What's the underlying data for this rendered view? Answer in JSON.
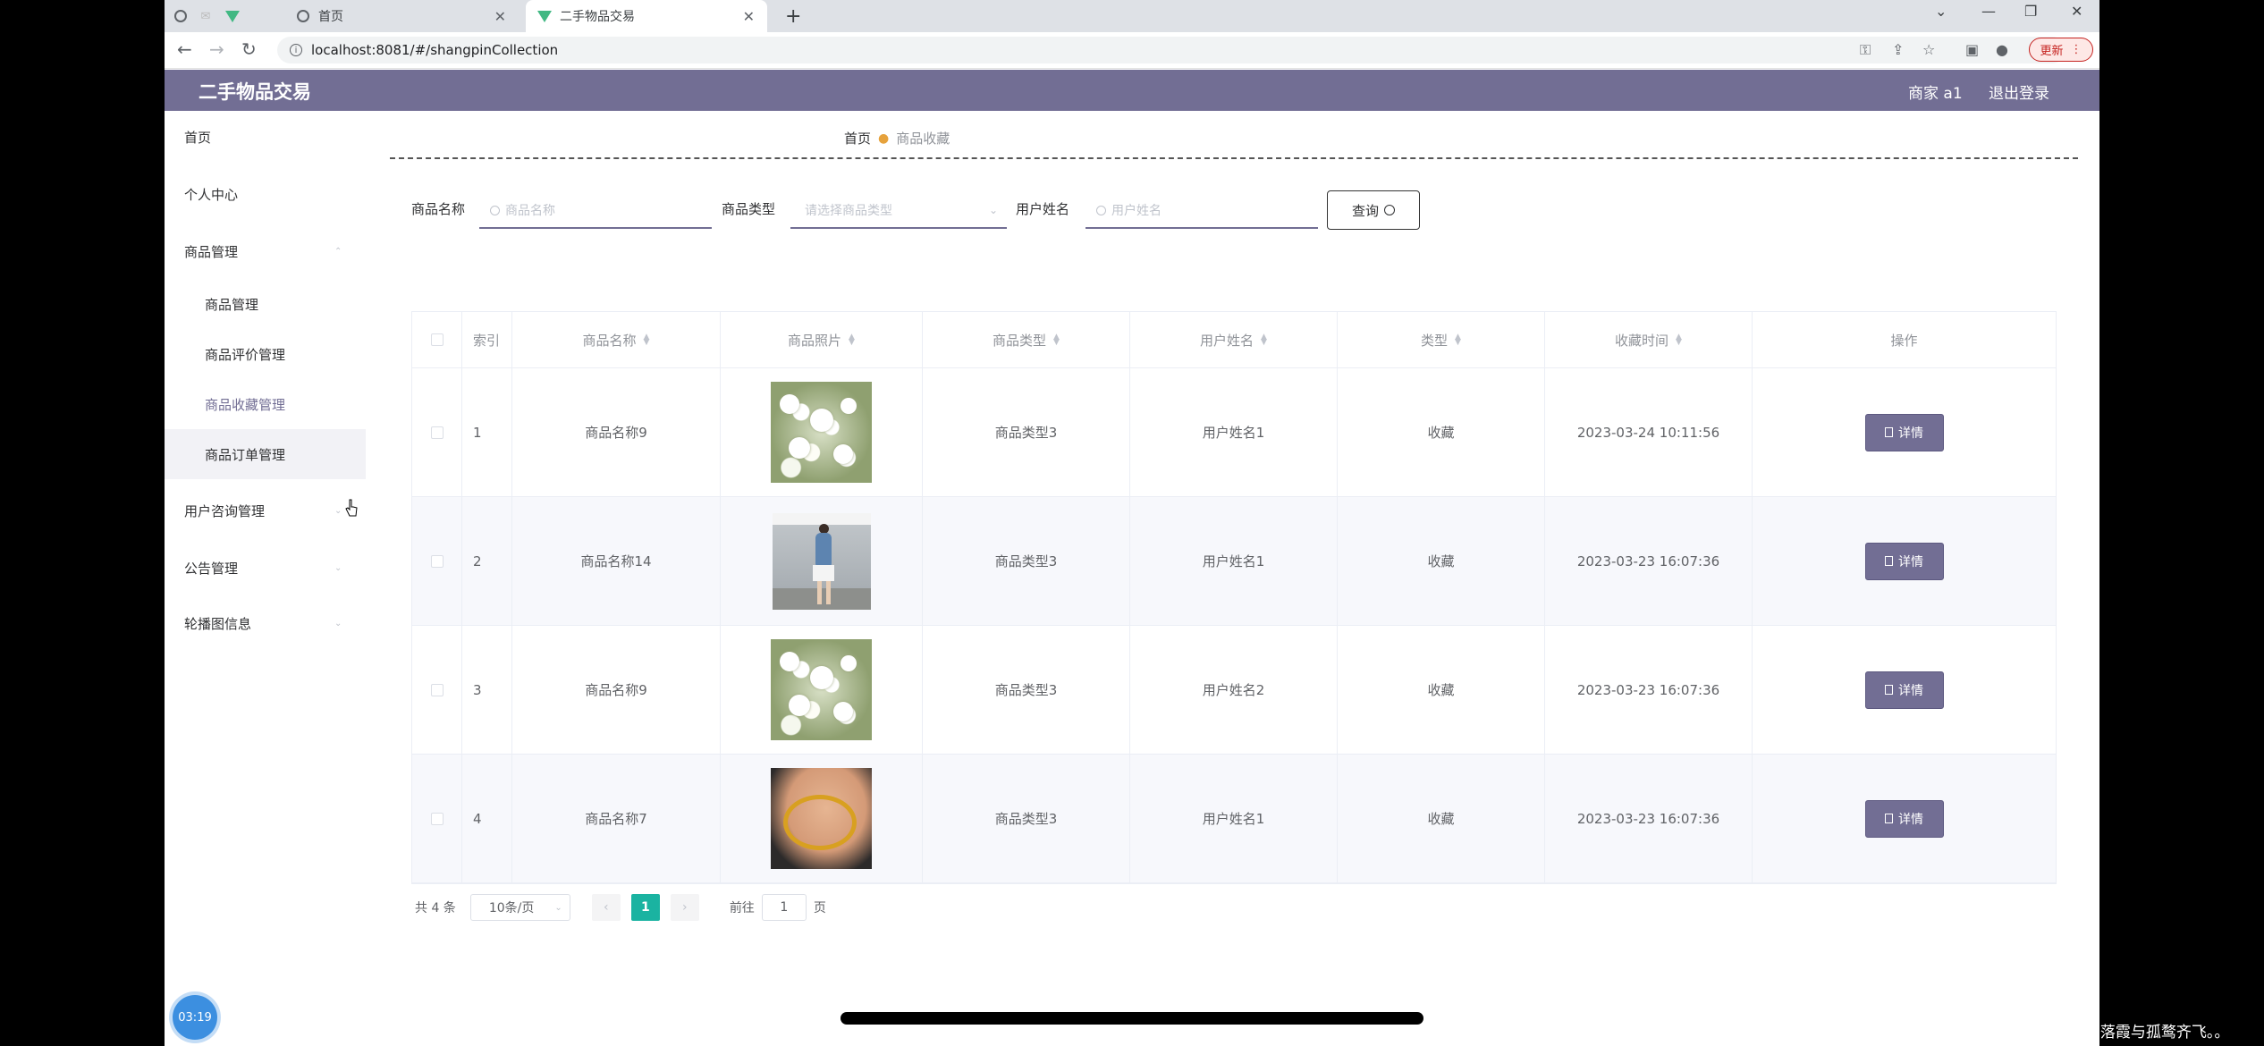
{
  "browser": {
    "tabs": [
      {
        "title": "",
        "icon": "globe-icon"
      },
      {
        "title": "",
        "icon": "mail-icon"
      },
      {
        "title": "",
        "icon": "vue-icon"
      },
      {
        "title": "首页",
        "icon": "globe-icon"
      },
      {
        "title": "二手物品交易",
        "icon": "vue-icon",
        "active": true
      }
    ],
    "new_tab": "+",
    "url": "localhost:8081/#/shangpinCollection",
    "update_label": "更新"
  },
  "header": {
    "title": "二手物品交易",
    "user": "商家 a1",
    "logout": "退出登录"
  },
  "sidebar": {
    "items": [
      {
        "label": "首页"
      },
      {
        "label": "个人中心"
      },
      {
        "label": "商品管理",
        "expanded": true
      },
      {
        "label": "用户咨询管理"
      },
      {
        "label": "公告管理"
      },
      {
        "label": "轮播图信息"
      }
    ],
    "sub_items": [
      {
        "label": "商品管理"
      },
      {
        "label": "商品评价管理"
      },
      {
        "label": "商品收藏管理",
        "active": true
      },
      {
        "label": "商品订单管理"
      }
    ]
  },
  "breadcrumb": {
    "home": "首页",
    "current": "商品收藏"
  },
  "filters": {
    "name_label": "商品名称",
    "name_placeholder": "商品名称",
    "type_label": "商品类型",
    "type_placeholder": "请选择商品类型",
    "user_label": "用户姓名",
    "user_placeholder": "用户姓名",
    "query_label": "查询"
  },
  "table": {
    "columns": [
      "索引",
      "商品名称",
      "商品照片",
      "商品类型",
      "用户姓名",
      "类型",
      "收藏时间",
      "操作"
    ],
    "detail_label": "详情",
    "rows": [
      {
        "index": "1",
        "name": "商品名称9",
        "image": "flowers",
        "category": "商品类型3",
        "user": "用户姓名1",
        "type": "收藏",
        "time": "2023-03-24 10:11:56"
      },
      {
        "index": "2",
        "name": "商品名称14",
        "image": "person",
        "category": "商品类型3",
        "user": "用户姓名1",
        "type": "收藏",
        "time": "2023-03-23 16:07:36"
      },
      {
        "index": "3",
        "name": "商品名称9",
        "image": "flowers",
        "category": "商品类型3",
        "user": "用户姓名2",
        "type": "收藏",
        "time": "2023-03-23 16:07:36"
      },
      {
        "index": "4",
        "name": "商品名称7",
        "image": "bangle",
        "category": "商品类型3",
        "user": "用户姓名1",
        "type": "收藏",
        "time": "2023-03-23 16:07:36"
      }
    ]
  },
  "pagination": {
    "total": "共 4 条",
    "page_size": "10条/页",
    "current_page": "1",
    "goto_prefix": "前往",
    "goto_value": "1",
    "goto_suffix": "页"
  },
  "overlay": {
    "timer": "03:19",
    "watermark": "CSDN @落霞与孤鹜齐飞。。"
  },
  "colors": {
    "theme": "#726e94",
    "pager_active": "#1ab3a1"
  }
}
